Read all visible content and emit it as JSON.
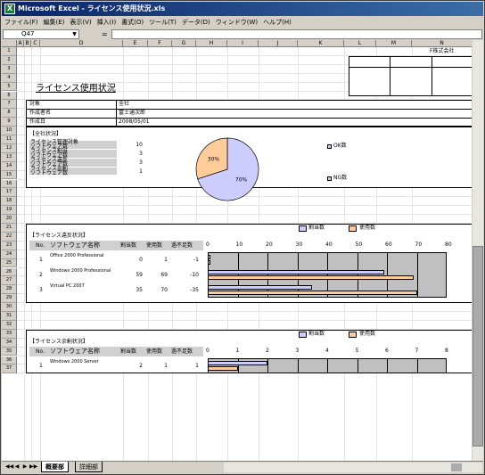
{
  "window": {
    "title": "Microsoft Excel - ライセンス使用状況.xls"
  },
  "menu": [
    "ファイル(F)",
    "編集(E)",
    "表示(V)",
    "挿入(I)",
    "書式(O)",
    "ツール(T)",
    "データ(D)",
    "ウィンドウ(W)",
    "ヘルプ(H)"
  ],
  "namebox": "Q47",
  "formula_eq": "=",
  "columns": [
    "A",
    "B",
    "C",
    "D",
    "E",
    "F",
    "G",
    "H",
    "I",
    "J",
    "K",
    "L",
    "M",
    "N"
  ],
  "rows": [
    "1",
    "2",
    "3",
    "4",
    "5",
    "6",
    "7",
    "8",
    "9",
    "10",
    "11",
    "12",
    "13",
    "14",
    "15",
    "16",
    "17",
    "18",
    "19",
    "20",
    "21",
    "22",
    "23",
    "24",
    "25",
    "26",
    "27",
    "28",
    "29",
    "30",
    "31",
    "32",
    "33",
    "34",
    "35",
    "36",
    "37"
  ],
  "sheet": {
    "company": "F株式会社",
    "title": "ライセンス使用状況",
    "info": [
      {
        "label": "対象",
        "value": "全社"
      },
      {
        "label": "作成者名",
        "value": "富士通次郎"
      },
      {
        "label": "作成日",
        "value": "2008/05/01"
      }
    ],
    "overall_label": "【全社状況】",
    "overall": [
      {
        "label1": "ライセンス管理対象",
        "label2": "ソフトウェア数",
        "value": "10"
      },
      {
        "label1": "ライセンス割当",
        "label2": "ソフトウェア数",
        "value": "3"
      },
      {
        "label1": "ライセンス違反",
        "label2": "ソフトウェア数",
        "value": "3"
      },
      {
        "label1": "ライセンス余剰",
        "label2": "ソフトウェア数",
        "value": "1"
      }
    ],
    "violation_label": "【ライセンス違反状況】",
    "surplus_label": "【ライセンス余剰状況】",
    "table_headers": {
      "no": "No.",
      "name": "ソフトウェア名称",
      "alloc": "割当数",
      "used": "使用数",
      "diff": "過不足数"
    },
    "violation_rows": [
      {
        "no": "1",
        "name": "Office 2000 Professional",
        "alloc": "0",
        "used": "1",
        "diff": "-1"
      },
      {
        "no": "2",
        "name": "Windows 2000 Professional",
        "alloc": "59",
        "used": "69",
        "diff": "-10"
      },
      {
        "no": "3",
        "name": "Virtual PC 2007",
        "alloc": "35",
        "used": "70",
        "diff": "-35"
      }
    ],
    "surplus_rows": [
      {
        "no": "1",
        "name": "Windows 2000 Server",
        "alloc": "2",
        "used": "1",
        "diff": "1"
      }
    ]
  },
  "legend": {
    "alloc": "割当数",
    "used": "使用数"
  },
  "colors": {
    "alloc": "#ccccff",
    "used": "#ffcc99",
    "plot": "#c0c0c0"
  },
  "chart_data": [
    {
      "type": "pie",
      "labels": [
        "OK数",
        "NG数"
      ],
      "values": [
        70,
        30
      ],
      "data_labels": [
        "70%",
        "30%"
      ]
    },
    {
      "type": "bar",
      "orientation": "horizontal",
      "categories": [
        "Office 2000 Professional",
        "Windows 2000 Professional",
        "Virtual PC 2007"
      ],
      "series": [
        {
          "name": "割当数",
          "values": [
            0,
            59,
            35
          ]
        },
        {
          "name": "使用数",
          "values": [
            1,
            69,
            70
          ]
        }
      ],
      "xlim": [
        0,
        80
      ],
      "ticks": [
        "0",
        "10",
        "20",
        "30",
        "40",
        "50",
        "60",
        "70",
        "80"
      ]
    },
    {
      "type": "bar",
      "orientation": "horizontal",
      "categories": [
        "Windows 2000 Server"
      ],
      "series": [
        {
          "name": "割当数",
          "values": [
            2
          ]
        },
        {
          "name": "使用数",
          "values": [
            1
          ]
        }
      ],
      "xlim": [
        0,
        8
      ],
      "ticks": [
        "0",
        "1",
        "2",
        "3",
        "4",
        "5",
        "6",
        "7",
        "8"
      ]
    }
  ],
  "tabs": [
    "概要部",
    "詳細部"
  ]
}
